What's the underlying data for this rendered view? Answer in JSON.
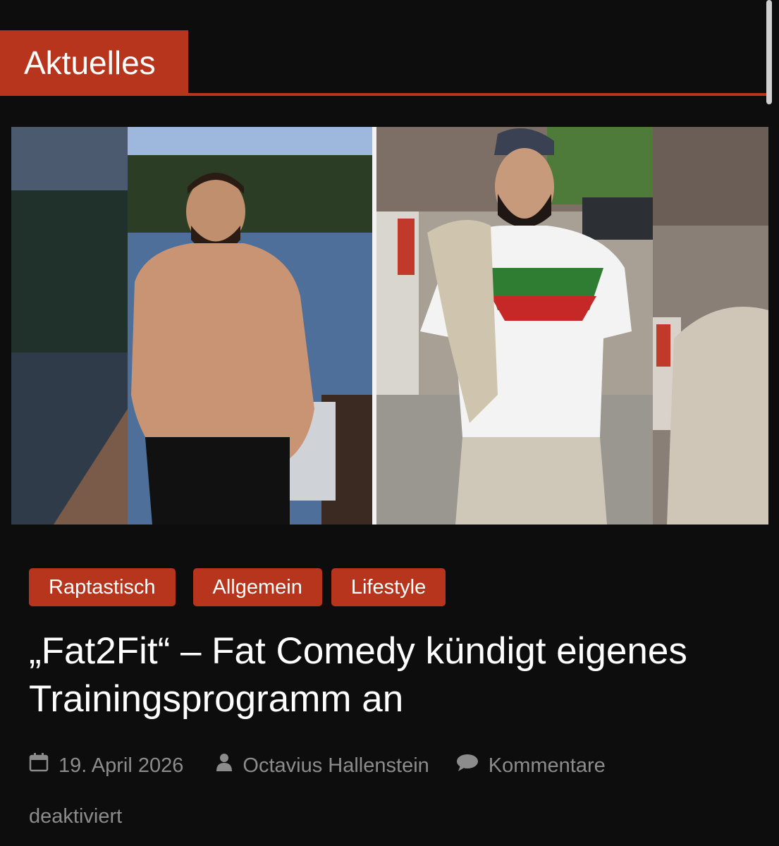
{
  "section": {
    "title": "Aktuelles"
  },
  "featured_image": {
    "alt": ""
  },
  "categories": [
    {
      "label": "Raptastisch"
    },
    {
      "label": "Allgemein"
    },
    {
      "label": "Lifestyle"
    }
  ],
  "article": {
    "title": "„Fat2Fit“ – Fat Comedy kündigt eigenes Trainingsprogramm an",
    "date": "19. April 2026",
    "author": "Octavius Hallenstein",
    "comments_line1": "Kommentare",
    "comments_line2": "deaktiviert"
  },
  "icons": {
    "date": "calendar-icon",
    "author": "user-icon",
    "comments": "comment-bubble-icon"
  },
  "colors": {
    "accent": "#b8351d",
    "background": "#0d0d0d",
    "meta_text": "#8c8c8c"
  }
}
